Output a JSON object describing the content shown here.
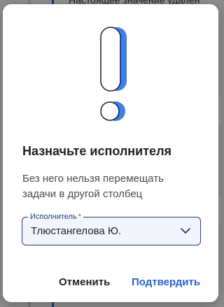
{
  "background": {
    "top_text": "Настоящее значение удален"
  },
  "dialog": {
    "title": "Назначьте исполнителя",
    "description": "Без него нельзя перемещать задачи в другой столбец",
    "field": {
      "label": "Исполнитель",
      "required_mark": "*",
      "value": "Тлюстангелова Ю."
    },
    "buttons": {
      "cancel": "Отменить",
      "confirm": "Подтвердить"
    }
  },
  "colors": {
    "accent": "#2a63c7",
    "illustration_blue": "#3b7ff0",
    "required": "#d93025",
    "field_border": "#1c3f78"
  },
  "icons": [
    "exclamation-illustration",
    "chevron-down-icon"
  ]
}
